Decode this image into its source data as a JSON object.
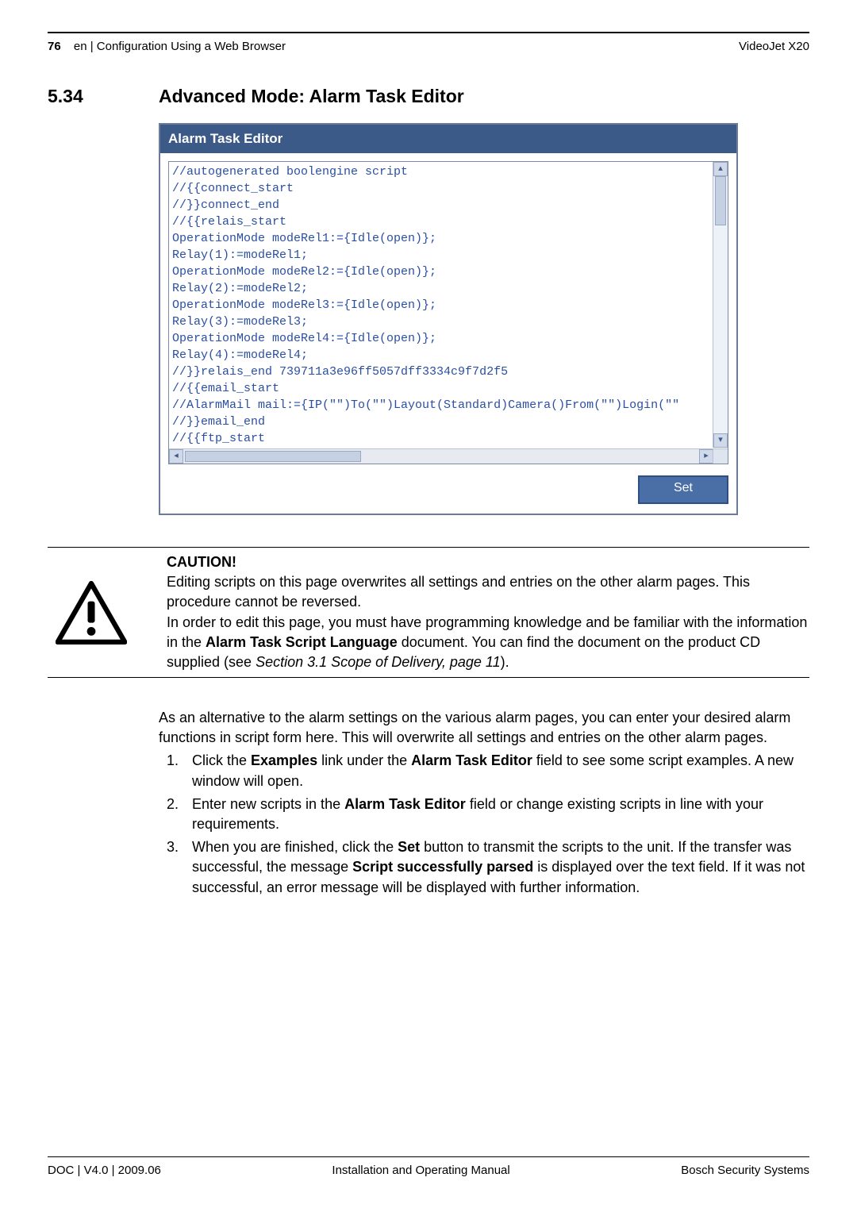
{
  "header": {
    "page_number": "76",
    "left_text": "en | Configuration Using a Web Browser",
    "right_text": "VideoJet X20"
  },
  "section": {
    "number": "5.34",
    "title": "Advanced Mode: Alarm Task Editor"
  },
  "editor": {
    "title": "Alarm Task Editor",
    "code": "//autogenerated boolengine script\n//{{connect_start\n//}}connect_end\n//{{relais_start\nOperationMode modeRel1:={Idle(open)};\nRelay(1):=modeRel1;\nOperationMode modeRel2:={Idle(open)};\nRelay(2):=modeRel2;\nOperationMode modeRel3:={Idle(open)};\nRelay(3):=modeRel3;\nOperationMode modeRel4:={Idle(open)};\nRelay(4):=modeRel4;\n//}}relais_end 739711a3e96ff5057dff3334c9f7d2f5\n//{{email_start\n//AlarmMail mail:={IP(\"\")To(\"\")Layout(Standard)Camera()From(\"\")Login(\"\"\n//}}email_end\n//{{ftp_start\n/*\nJpegPosting posting:={IP(\"\")Login(\"\")Password(\"\")Suffix(Overwrite)Path(\"\n*/",
    "set_button": "Set"
  },
  "caution": {
    "title": "CAUTION!",
    "line1": "Editing scripts on this page overwrites all settings and entries on the other alarm pages. This procedure cannot be reversed.",
    "line2_pre": "In order to edit this page, you must have programming knowledge and be familiar with the information in the ",
    "line2_bold": "Alarm Task Script Language",
    "line2_mid": " document. You can find the document on the product CD supplied (see ",
    "line2_italic": "Section 3.1 Scope of Delivery, page 11",
    "line2_post": ")."
  },
  "body": {
    "para": "As an alternative to the alarm settings on the various alarm pages, you can enter your desired alarm functions in script form here. This will overwrite all settings and entries on the other alarm pages.",
    "li1_pre": "Click the ",
    "li1_b1": "Examples",
    "li1_mid": " link under the ",
    "li1_b2": "Alarm Task Editor",
    "li1_post": " field to see some script examples. A new window will open.",
    "li2_pre": "Enter new scripts in the ",
    "li2_b1": "Alarm Task Editor",
    "li2_post": " field or change existing scripts in line with your requirements.",
    "li3_pre": "When you are finished, click the ",
    "li3_b1": "Set",
    "li3_mid": " button to transmit the scripts to the unit. If the transfer was successful, the message ",
    "li3_b2": "Script successfully parsed",
    "li3_post": " is displayed over the text field. If it was not successful, an error message will be displayed with further information."
  },
  "footer": {
    "left": "DOC | V4.0 | 2009.06",
    "center": "Installation and Operating Manual",
    "right": "Bosch Security Systems"
  }
}
